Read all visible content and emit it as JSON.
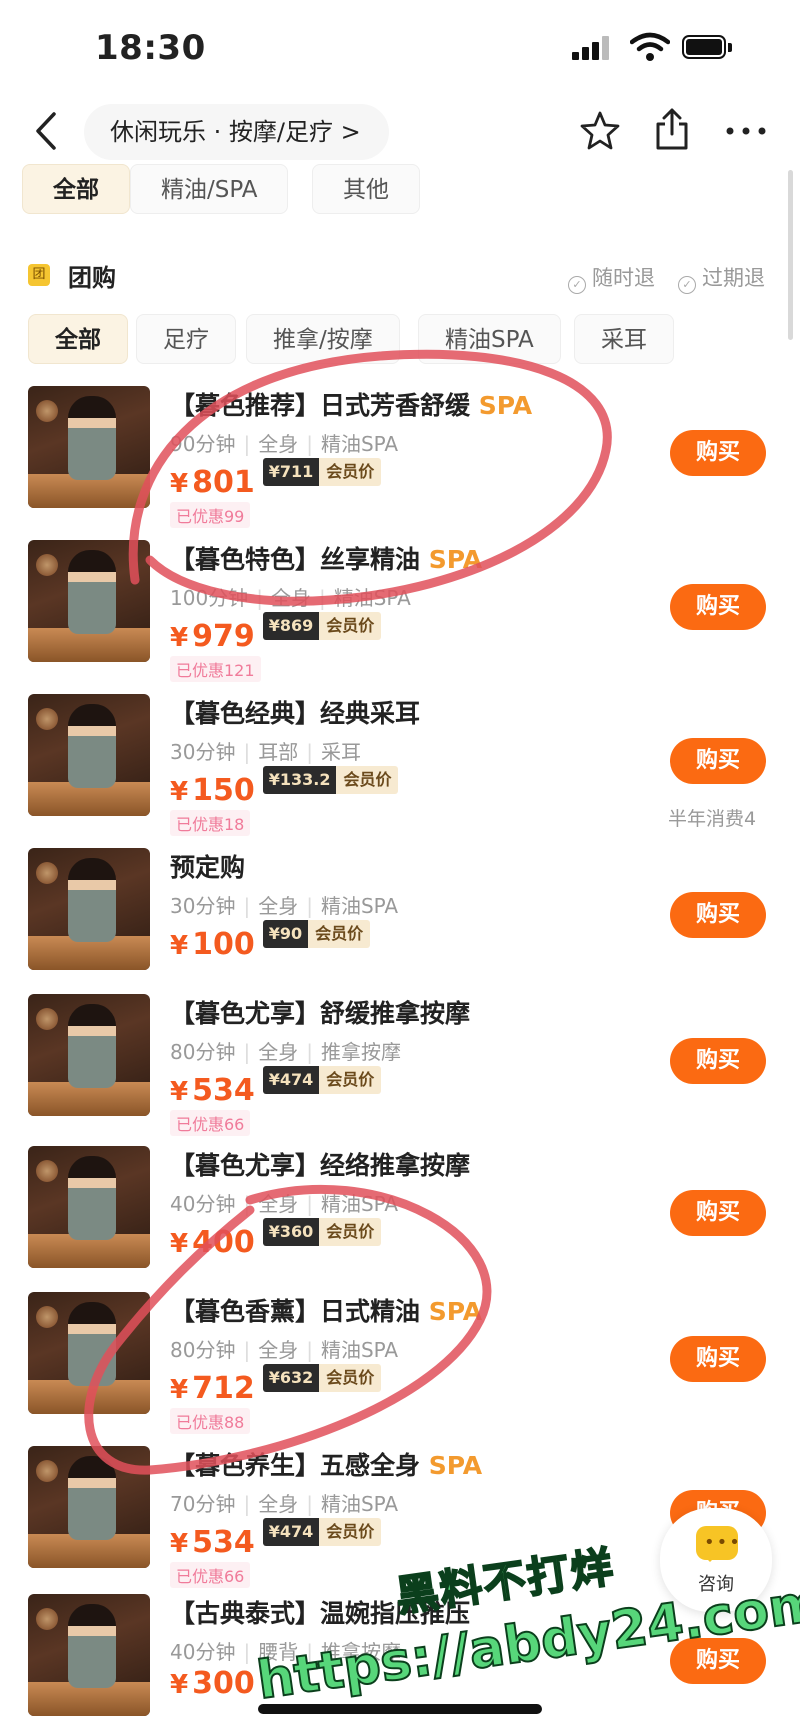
{
  "status_bar": {
    "time": "18:30"
  },
  "nav": {
    "breadcrumb": "休闲玩乐 · 按摩/足疗 >",
    "icons": [
      "back-icon",
      "star-icon",
      "share-icon",
      "more-icon"
    ]
  },
  "category_tabs": [
    "全部",
    "精油/SPA",
    "其他"
  ],
  "group_buy": {
    "badge": "团",
    "title": "团购",
    "policies": [
      "随时退",
      "过期退"
    ],
    "tabs": [
      "全部",
      "足疗",
      "推拿/按摩",
      "精油SPA",
      "采耳"
    ]
  },
  "deals": [
    {
      "title": "【暮色推荐】日式芳香舒缓",
      "spa": "SPA",
      "meta": [
        "90分钟",
        "全身",
        "精油SPA"
      ],
      "price": "801",
      "vip": "¥711",
      "vip_label": "会员价",
      "saved": "已优惠99",
      "button": "购买",
      "sold": ""
    },
    {
      "title": "【暮色特色】丝享精油",
      "spa": "SPA",
      "meta": [
        "100分钟",
        "全身",
        "精油SPA"
      ],
      "price": "979",
      "vip": "¥869",
      "vip_label": "会员价",
      "saved": "已优惠121",
      "button": "购买",
      "sold": ""
    },
    {
      "title": "【暮色经典】经典采耳",
      "spa": "",
      "meta": [
        "30分钟",
        "耳部",
        "采耳"
      ],
      "price": "150",
      "vip": "¥133.2",
      "vip_label": "会员价",
      "saved": "已优惠18",
      "button": "购买",
      "sold": "半年消费4"
    },
    {
      "title": "预定购",
      "spa": "",
      "meta": [
        "30分钟",
        "全身",
        "精油SPA"
      ],
      "price": "100",
      "vip": "¥90",
      "vip_label": "会员价",
      "saved": "",
      "button": "购买",
      "sold": ""
    },
    {
      "title": "【暮色尤享】舒缓推拿按摩",
      "spa": "",
      "meta": [
        "80分钟",
        "全身",
        "推拿按摩"
      ],
      "price": "534",
      "vip": "¥474",
      "vip_label": "会员价",
      "saved": "已优惠66",
      "button": "购买",
      "sold": ""
    },
    {
      "title": "【暮色尤享】经络推拿按摩",
      "spa": "",
      "meta": [
        "40分钟",
        "全身",
        "精油SPA"
      ],
      "price": "400",
      "vip": "¥360",
      "vip_label": "会员价",
      "saved": "",
      "button": "购买",
      "sold": ""
    },
    {
      "title": "【暮色香薰】日式精油",
      "spa": "SPA",
      "meta": [
        "80分钟",
        "全身",
        "精油SPA"
      ],
      "price": "712",
      "vip": "¥632",
      "vip_label": "会员价",
      "saved": "已优惠88",
      "button": "购买",
      "sold": ""
    },
    {
      "title": "【暮色养生】五感全身",
      "spa": "SPA",
      "meta": [
        "70分钟",
        "全身",
        "精油SPA"
      ],
      "price": "534",
      "vip": "¥474",
      "vip_label": "会员价",
      "saved": "已优惠66",
      "button": "购买",
      "sold": ""
    },
    {
      "title": "【古典泰式】温婉指压推压",
      "spa": "",
      "meta": [
        "40分钟",
        "腰背",
        "推拿按摩"
      ],
      "price": "300",
      "vip": "",
      "vip_label": "",
      "saved": "",
      "button": "购买",
      "sold": ""
    }
  ],
  "yen_symbol": "¥",
  "chat": {
    "label": "咨询"
  },
  "watermark": {
    "line1": "黑料不打烊",
    "line2": "https://abdy24.com"
  },
  "colors": {
    "accent": "#fb6a12",
    "price": "#f45a1f",
    "spa": "#f39a2e",
    "annotation": "#e0505a",
    "watermark": "#57d67a"
  }
}
